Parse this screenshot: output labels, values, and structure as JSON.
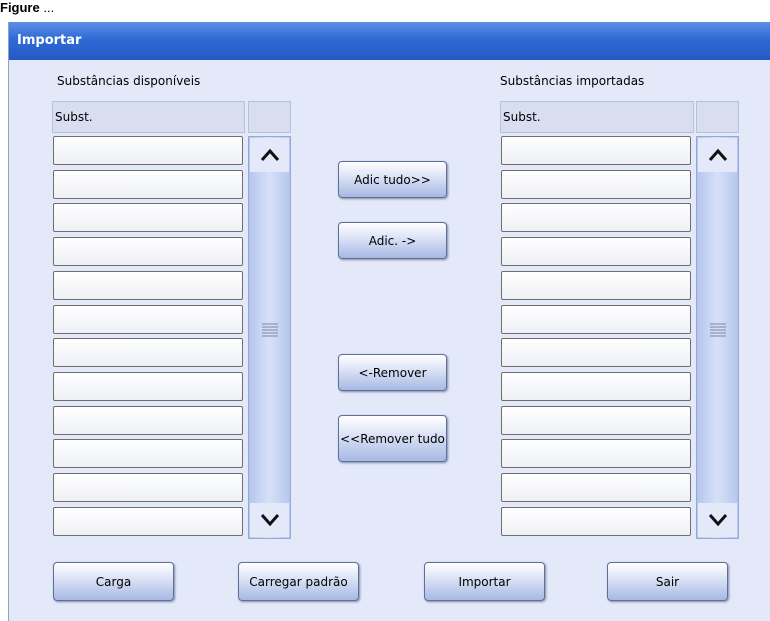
{
  "page_header": {
    "figure_label": "Figure",
    "figure_number": "..."
  },
  "dialog": {
    "title": "Importar"
  },
  "available": {
    "title": "Substâncias disponíveis",
    "column_header": "Subst.",
    "rows": [
      "",
      "",
      "",
      "",
      "",
      "",
      "",
      "",
      "",
      "",
      "",
      ""
    ]
  },
  "imported": {
    "title": "Substâncias importadas",
    "column_header": "Subst.",
    "rows": [
      "",
      "",
      "",
      "",
      "",
      "",
      "",
      "",
      "",
      "",
      "",
      ""
    ]
  },
  "transfer_buttons": {
    "add_all": "Adic tudo>>",
    "add": "Adic. ->",
    "remove": "<-Remover",
    "remove_all": "<<Remover tudo"
  },
  "bottom_buttons": {
    "load": "Carga",
    "load_default": "Carregar padrão",
    "import": "Importar",
    "exit": "Sair"
  },
  "icons": {
    "scroll_up": "chevron-up-icon",
    "scroll_down": "chevron-down-icon",
    "scroll_thumb": "grip-lines-icon"
  }
}
